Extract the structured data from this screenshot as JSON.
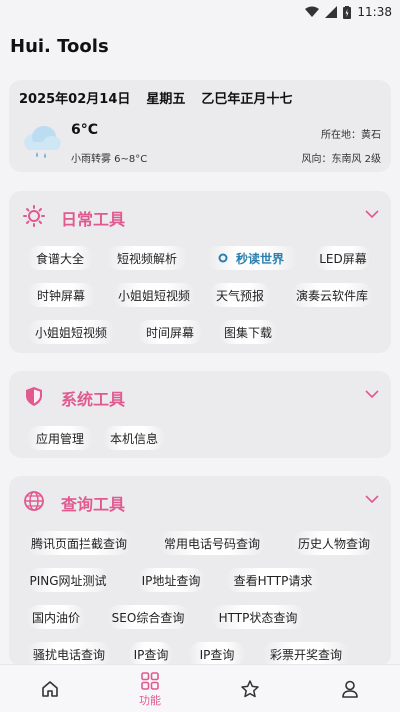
{
  "status": {
    "time": "11:38"
  },
  "app": {
    "title": "Hui. Tools"
  },
  "date_card": {
    "date": "2025年02月14日",
    "weekday": "星期五",
    "lunar": "乙巳年正月十七",
    "temperature": "6°C",
    "condition": "小雨转雾 6~8°C",
    "location": "所在地：黄石",
    "wind": "风向：东南风 2级"
  },
  "sections": {
    "daily": {
      "title": "日常工具",
      "icon": "sun-icon",
      "items": [
        "食谱大全",
        "短视频解析",
        "秒读世界",
        "LED屏幕",
        "时钟屏幕",
        "小姐姐短视频",
        "天气预报",
        "演奏云软件库",
        "小姐姐短视频",
        "时间屏幕",
        "图集下载"
      ]
    },
    "system": {
      "title": "系统工具",
      "icon": "shield-icon",
      "items": [
        "应用管理",
        "本机信息"
      ]
    },
    "query": {
      "title": "查询工具",
      "icon": "globe-icon",
      "items": [
        "腾讯页面拦截查询",
        "常用电话号码查询",
        "历史人物查询",
        "PING网址测试",
        "IP地址查询",
        "查看HTTP请求",
        "国内油价",
        "SEO综合查询",
        "HTTP状态查询",
        "骚扰电话查询",
        "IP查询",
        "IP查询",
        "彩票开奖查询"
      ]
    }
  },
  "nav": {
    "tools_label": "功能"
  },
  "colors": {
    "accent": "#e05a90",
    "active_chip": "#2a7fb0"
  }
}
